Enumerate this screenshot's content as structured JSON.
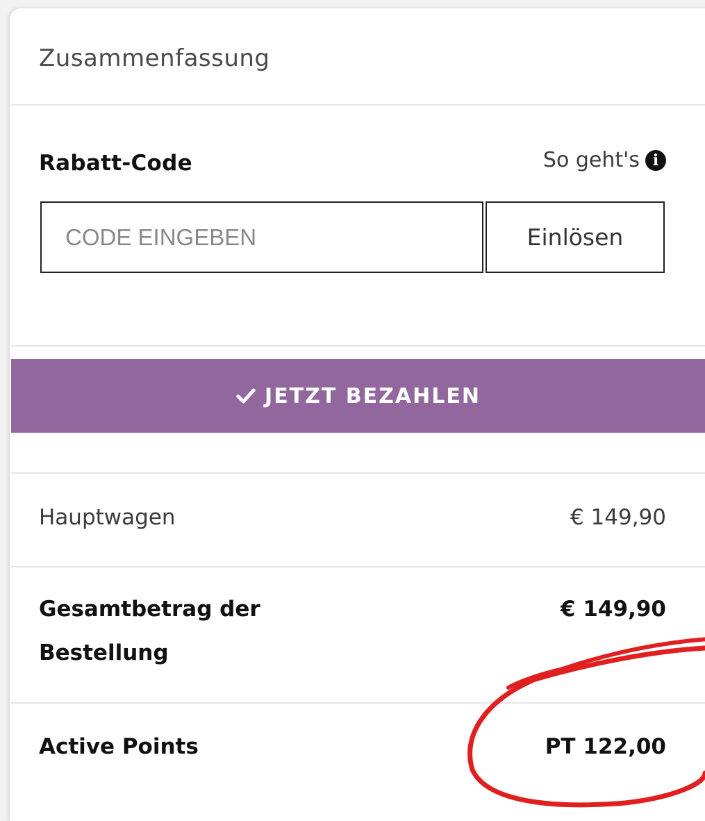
{
  "summary": {
    "title": "Zusammenfassung"
  },
  "discount": {
    "label": "Rabatt-Code",
    "howto_label": "So geht's",
    "input_placeholder": "CODE EINGEBEN",
    "redeem_label": "Einlösen"
  },
  "pay_button": {
    "label": "JETZT BEZAHLEN",
    "color": "#92679e"
  },
  "rows": {
    "main_cart": {
      "label": "Hauptwagen",
      "value": "€ 149,90"
    },
    "order_total": {
      "label_line1": "Gesamtbetrag der",
      "label_line2": "Bestellung",
      "value": "€ 149,90"
    },
    "active_points": {
      "label": "Active Points",
      "value": "PT 122,00"
    }
  },
  "annotation": {
    "color": "#e02020"
  }
}
